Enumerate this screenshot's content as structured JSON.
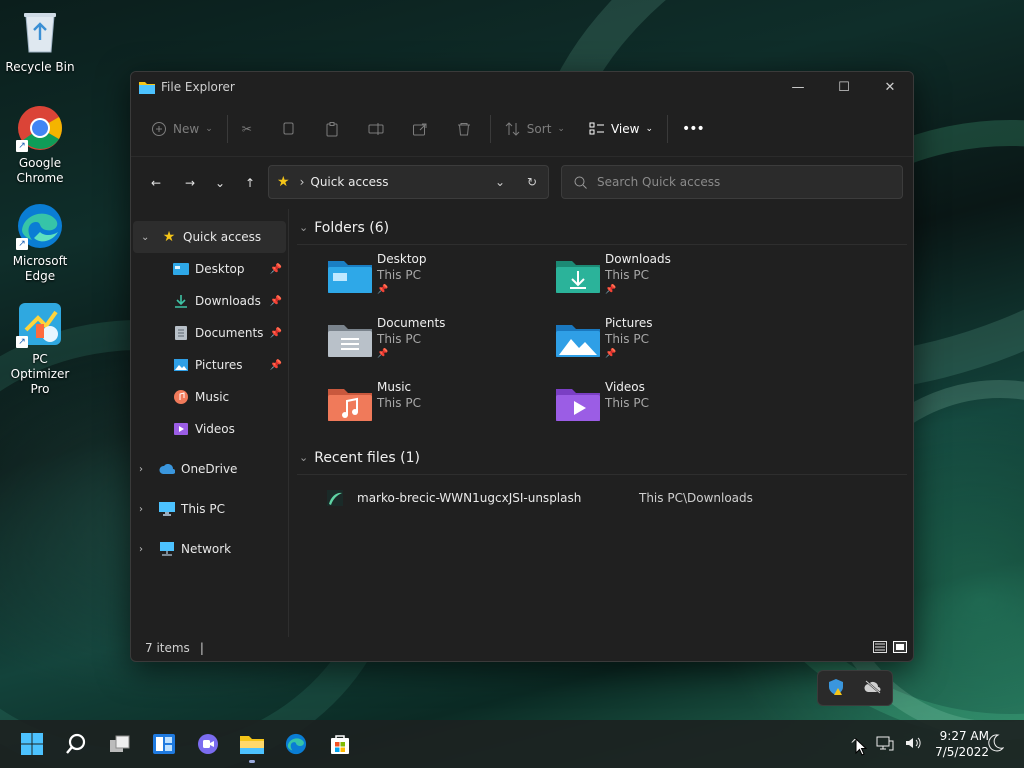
{
  "desktop": {
    "icons": [
      {
        "label": "Recycle Bin",
        "icon": "recycle-bin-icon"
      },
      {
        "label": "Google\nChrome",
        "icon": "chrome-icon"
      },
      {
        "label": "Microsoft\nEdge",
        "icon": "edge-icon"
      },
      {
        "label": "PC Optimizer\nPro",
        "icon": "pc-optimizer-icon"
      }
    ]
  },
  "window": {
    "title": "File Explorer",
    "commands": {
      "new": "New",
      "sort": "Sort",
      "view": "View",
      "more": "•••"
    },
    "address": {
      "location": "Quick access"
    },
    "search": {
      "placeholder": "Search Quick access"
    },
    "sidebar": {
      "quick_access": "Quick access",
      "items": [
        {
          "label": "Desktop"
        },
        {
          "label": "Downloads"
        },
        {
          "label": "Documents"
        },
        {
          "label": "Pictures"
        },
        {
          "label": "Music"
        },
        {
          "label": "Videos"
        }
      ],
      "onedrive": "OneDrive",
      "this_pc": "This PC",
      "network": "Network"
    },
    "folders_header": "Folders (6)",
    "folders": [
      {
        "name": "Desktop",
        "sub": "This PC",
        "pinned": true,
        "color": "#2ea8e8"
      },
      {
        "name": "Downloads",
        "sub": "This PC",
        "pinned": true,
        "color": "#2bb39a"
      },
      {
        "name": "Documents",
        "sub": "This PC",
        "pinned": true,
        "color": "#9aa3ad"
      },
      {
        "name": "Pictures",
        "sub": "This PC",
        "pinned": true,
        "color": "#2f9fe6"
      },
      {
        "name": "Music",
        "sub": "This PC",
        "pinned": false,
        "color": "#f07a5a"
      },
      {
        "name": "Videos",
        "sub": "This PC",
        "pinned": false,
        "color": "#9b5de5"
      }
    ],
    "recent_header": "Recent files (1)",
    "recent": [
      {
        "name": "marko-brecic-WWN1ugcxJSI-unsplash",
        "location": "This PC\\Downloads"
      }
    ],
    "status": {
      "items": "7 items",
      "caret": "|"
    }
  },
  "taskbar": {
    "time": "9:27 AM",
    "date": "7/5/2022"
  },
  "colors": {
    "accent": "#4cc2ff",
    "folder_yellow": "#f5c518"
  }
}
